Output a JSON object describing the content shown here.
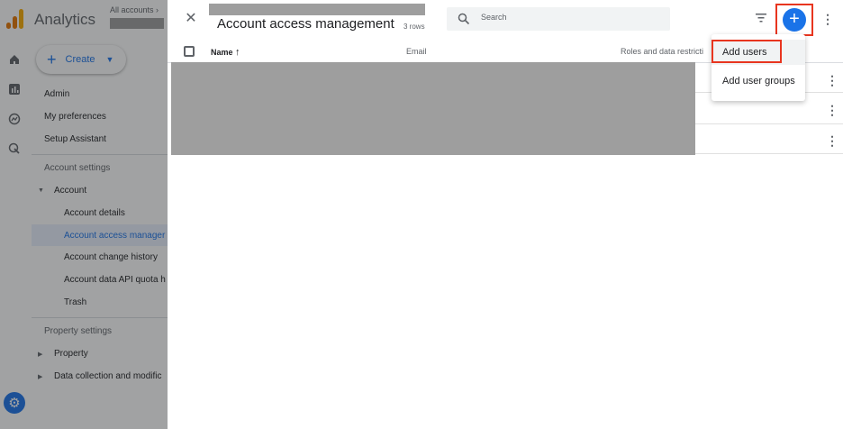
{
  "app": {
    "name": "Analytics",
    "breadcrumb": "All accounts",
    "breadcrumb_chevron": "chevron-right-icon",
    "logo_colors": [
      "#f9ab00",
      "#e37400",
      "#e37400"
    ]
  },
  "rail": {
    "icons": [
      "home-icon",
      "reports-icon",
      "explore-icon",
      "advertising-icon"
    ],
    "settings_icon": "gear-icon"
  },
  "create_button": {
    "label": "Create"
  },
  "nav": {
    "top_items": [
      "Admin",
      "My preferences",
      "Setup Assistant"
    ],
    "account_section": "Account settings",
    "account_group": "Account",
    "account_items": [
      "Account details",
      "Account access manager",
      "Account change history",
      "Account data API quota h",
      "Trash"
    ],
    "property_section": "Property settings",
    "property_groups": [
      "Property",
      "Data collection and modific"
    ]
  },
  "panel": {
    "title": "Account access management",
    "row_count": "3 rows",
    "search_placeholder": "Search",
    "columns": {
      "name": "Name",
      "email": "Email",
      "roles": "Roles and data restricti"
    },
    "sort_indicator": "arrow-up-icon"
  },
  "menu": {
    "items": [
      "Add users",
      "Add user groups"
    ]
  },
  "colors": {
    "accent": "#1a73e8",
    "highlight": "#e8351f",
    "redaction": "#9e9e9e"
  }
}
